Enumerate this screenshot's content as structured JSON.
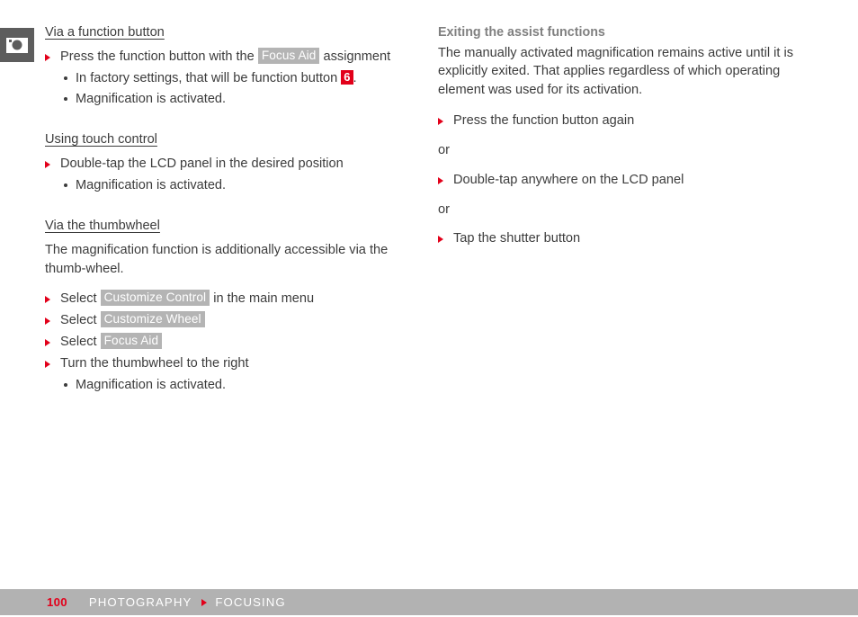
{
  "chapter_icon": {
    "name": "camera-icon"
  },
  "left_column": {
    "section1": {
      "heading": "Via a function button",
      "steps": [
        {
          "prefix": "Press the function button with the ",
          "badge": "Focus Aid",
          "suffix": " assignment"
        }
      ],
      "subitems": [
        {
          "prefix": "In factory settings, that will be function button ",
          "fn_badge": "6",
          "suffix": "."
        },
        {
          "text": "Magnification is activated."
        }
      ]
    },
    "section2": {
      "heading": "Using touch control",
      "step": "Double-tap the LCD panel in the desired position",
      "subitem": "Magnification is activated."
    },
    "section3": {
      "heading": "Via the thumbwheel",
      "paragraph": "The magnification function is additionally accessible via the thumb-wheel.",
      "steps": [
        {
          "prefix": "Select ",
          "badge": "Customize Control",
          "suffix": " in the main menu"
        },
        {
          "prefix": "Select ",
          "badge": "Customize Wheel",
          "suffix": ""
        },
        {
          "prefix": "Select ",
          "badge": "Focus Aid",
          "suffix": ""
        },
        {
          "prefix": "Turn the thumbwheel to the right",
          "badge": "",
          "suffix": ""
        }
      ],
      "subitem": "Magnification is activated."
    }
  },
  "right_column": {
    "heading": "Exiting the assist functions",
    "paragraph": "The manually activated magnification remains active until it is explicitly exited. That applies regardless of which operating element was used for its activation.",
    "step1": "Press the function button again",
    "or1": "or",
    "step2": "Double-tap anywhere on the LCD panel",
    "or2": "or",
    "step3": "Tap the shutter button"
  },
  "footer": {
    "page_number": "100",
    "chapter": "PHOTOGRAPHY",
    "section": "FOCUSING"
  },
  "colors": {
    "accent_red": "#e2001a",
    "badge_gray": "#b4b4b4",
    "footer_gray": "#b2b2b2",
    "icon_gray": "#5d5d5d",
    "text_dark": "#3c3c3c",
    "heading_gray": "#808080"
  }
}
